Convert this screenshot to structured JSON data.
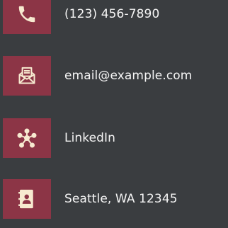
{
  "contacts": [
    {
      "icon": "phone-icon",
      "text": "(123) 456-7890"
    },
    {
      "icon": "email-icon",
      "text": "email@example.com"
    },
    {
      "icon": "linkedin-network-icon",
      "text": "LinkedIn"
    },
    {
      "icon": "address-book-icon",
      "text": "Seattle, WA 12345"
    }
  ],
  "colors": {
    "background": "#3a3d40",
    "icon_tile": "#8c3546",
    "icon_glyph": "#f7ead0",
    "text": "#f5f5f5"
  }
}
